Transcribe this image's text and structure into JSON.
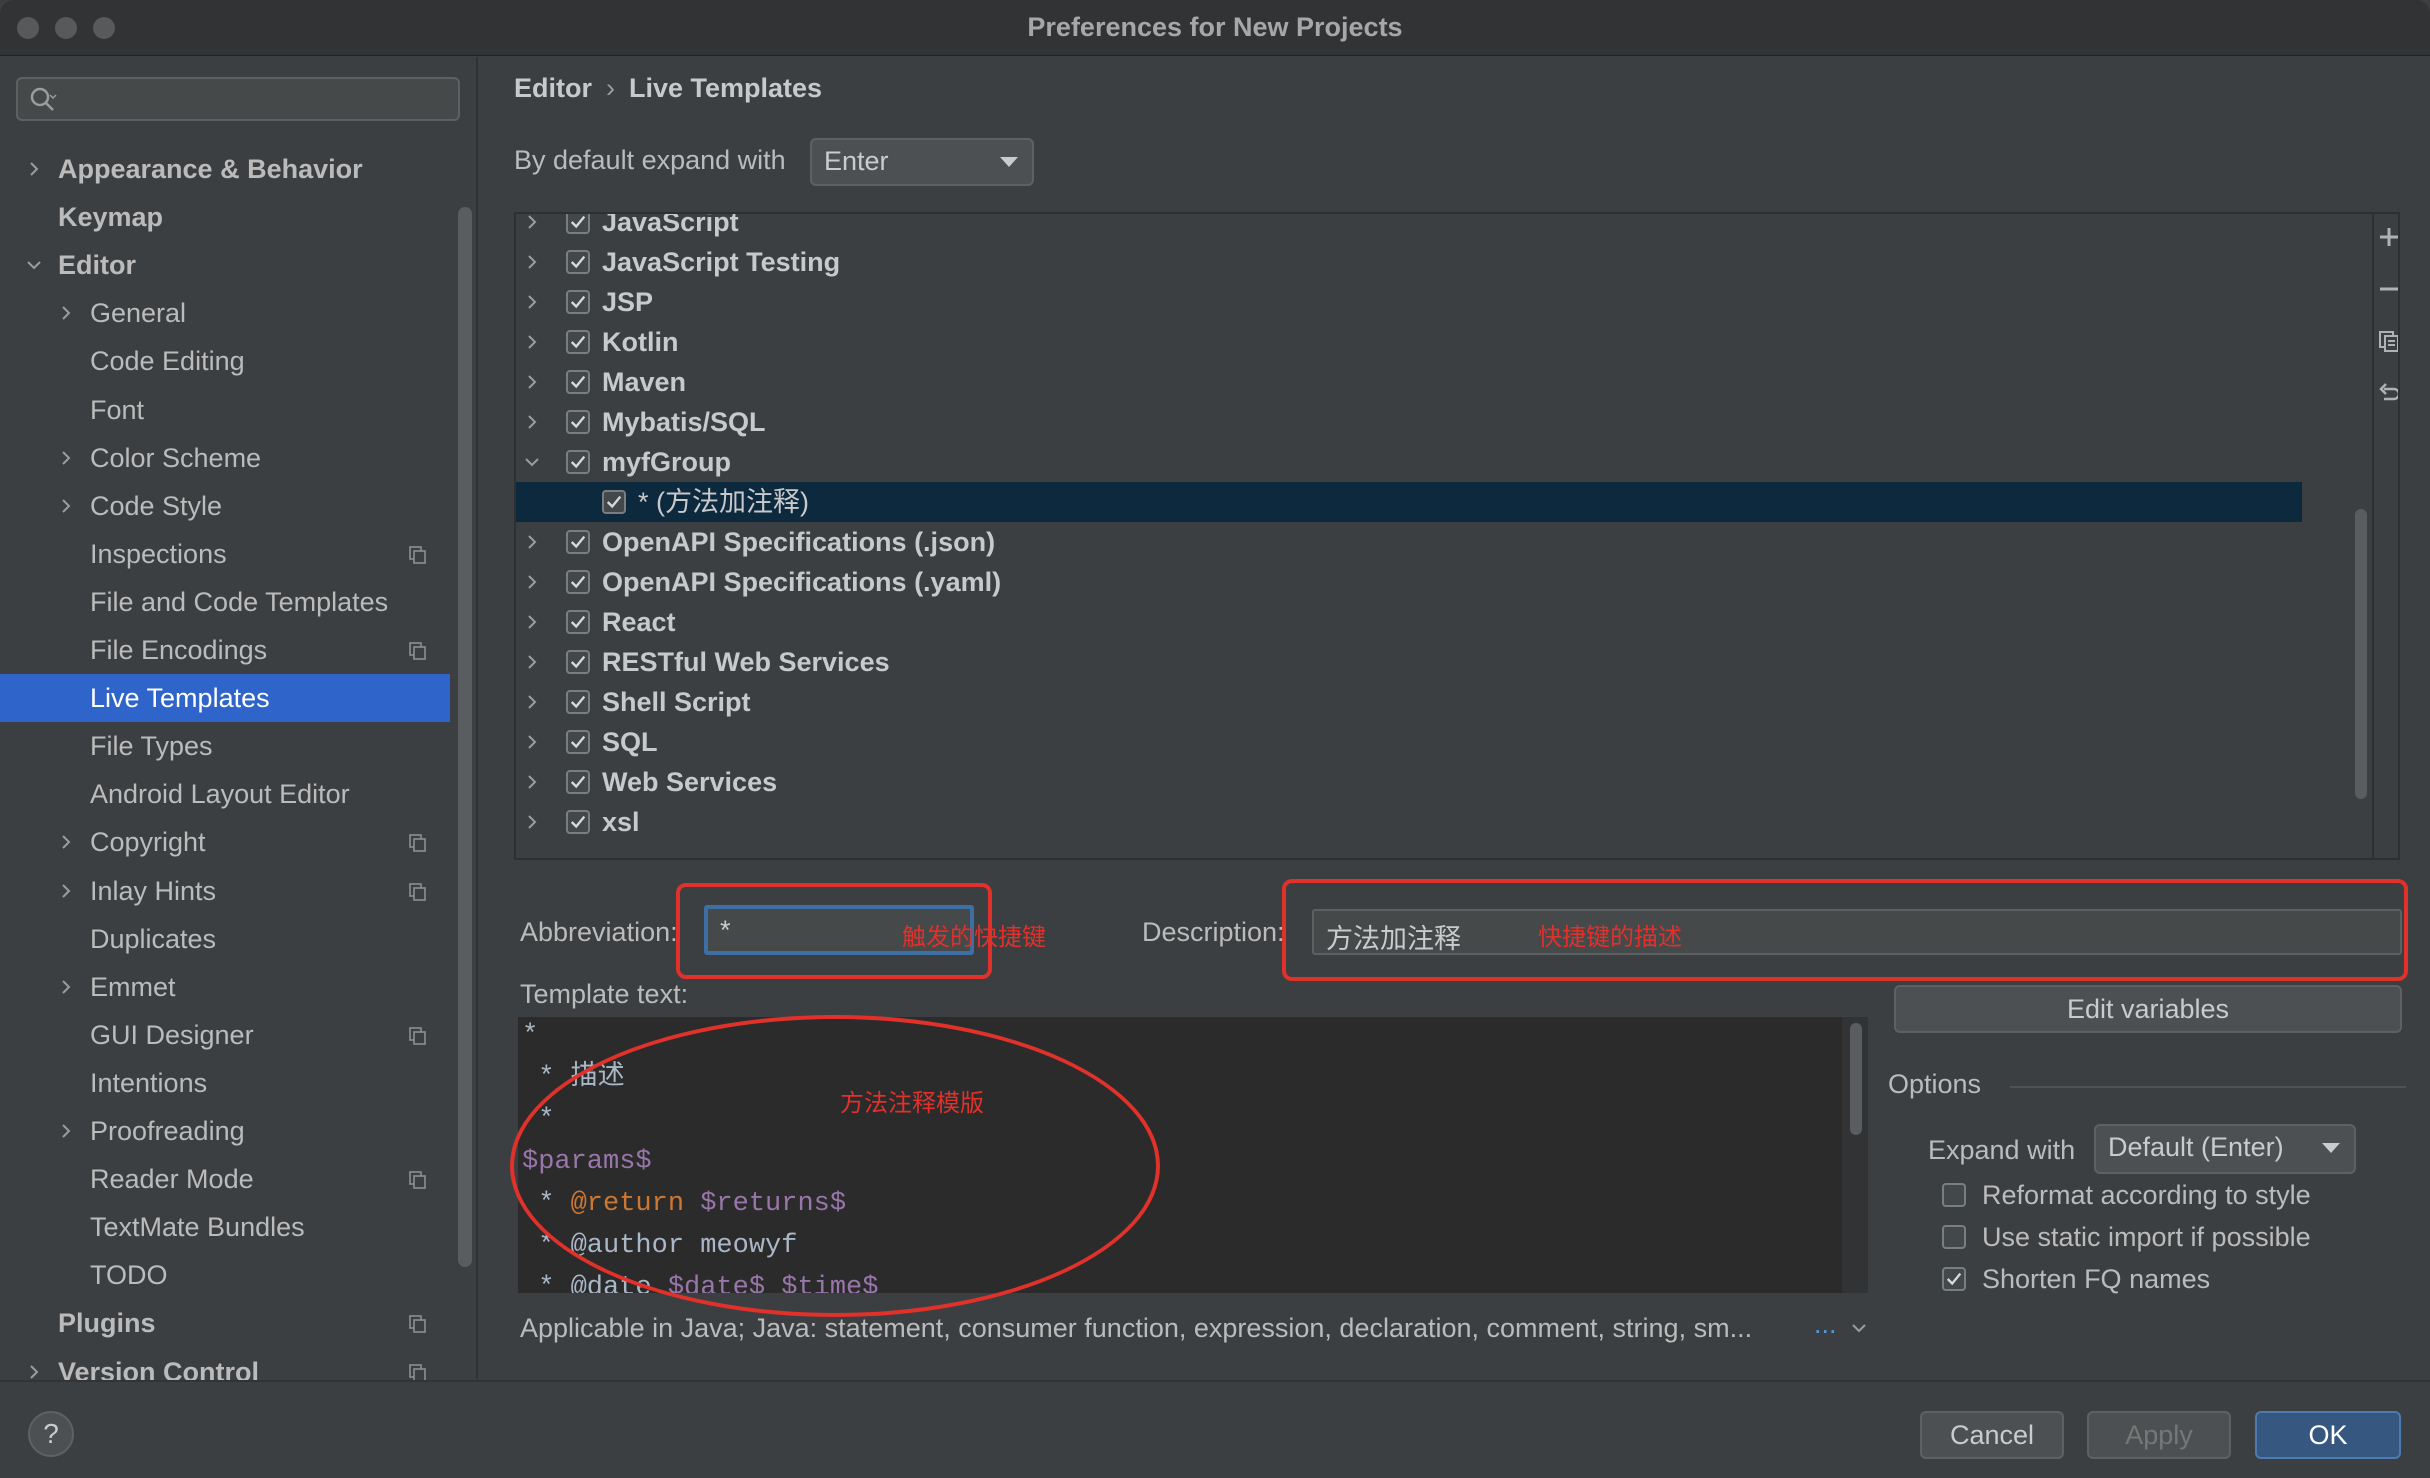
{
  "window": {
    "title": "Preferences for New Projects"
  },
  "search": {
    "placeholder": ""
  },
  "sidebar": {
    "items": [
      {
        "label": "Appearance & Behavior",
        "bold": true,
        "chevron": "right",
        "project": false
      },
      {
        "label": "Keymap",
        "bold": true,
        "chevron": "",
        "project": false
      },
      {
        "label": "Editor",
        "bold": true,
        "chevron": "down",
        "project": false
      },
      {
        "label": "General",
        "bold": false,
        "chevron": "right",
        "project": false
      },
      {
        "label": "Code Editing",
        "bold": false,
        "chevron": "",
        "project": false
      },
      {
        "label": "Font",
        "bold": false,
        "chevron": "",
        "project": false
      },
      {
        "label": "Color Scheme",
        "bold": false,
        "chevron": "right",
        "project": false
      },
      {
        "label": "Code Style",
        "bold": false,
        "chevron": "right",
        "project": false
      },
      {
        "label": "Inspections",
        "bold": false,
        "chevron": "",
        "project": true
      },
      {
        "label": "File and Code Templates",
        "bold": false,
        "chevron": "",
        "project": false
      },
      {
        "label": "File Encodings",
        "bold": false,
        "chevron": "",
        "project": true
      },
      {
        "label": "Live Templates",
        "bold": false,
        "chevron": "",
        "project": false,
        "selected": true
      },
      {
        "label": "File Types",
        "bold": false,
        "chevron": "",
        "project": false
      },
      {
        "label": "Android Layout Editor",
        "bold": false,
        "chevron": "",
        "project": false
      },
      {
        "label": "Copyright",
        "bold": false,
        "chevron": "right",
        "project": true
      },
      {
        "label": "Inlay Hints",
        "bold": false,
        "chevron": "right",
        "project": true
      },
      {
        "label": "Duplicates",
        "bold": false,
        "chevron": "",
        "project": false
      },
      {
        "label": "Emmet",
        "bold": false,
        "chevron": "right",
        "project": false
      },
      {
        "label": "GUI Designer",
        "bold": false,
        "chevron": "",
        "project": true
      },
      {
        "label": "Intentions",
        "bold": false,
        "chevron": "",
        "project": false
      },
      {
        "label": "Proofreading",
        "bold": false,
        "chevron": "right",
        "project": false
      },
      {
        "label": "Reader Mode",
        "bold": false,
        "chevron": "",
        "project": true
      },
      {
        "label": "TextMate Bundles",
        "bold": false,
        "chevron": "",
        "project": false
      },
      {
        "label": "TODO",
        "bold": false,
        "chevron": "",
        "project": false
      },
      {
        "label": "Plugins",
        "bold": true,
        "chevron": "",
        "project": true
      },
      {
        "label": "Version Control",
        "bold": true,
        "chevron": "right",
        "project": true
      }
    ]
  },
  "breadcrumb": {
    "parent": "Editor",
    "separator": "›",
    "current": "Live Templates"
  },
  "expand": {
    "label": "By default expand with",
    "value": "Enter"
  },
  "template_groups": [
    {
      "label": "JavaScript",
      "checked": true,
      "expanded": false
    },
    {
      "label": "JavaScript Testing",
      "checked": true,
      "expanded": false
    },
    {
      "label": "JSP",
      "checked": true,
      "expanded": false
    },
    {
      "label": "Kotlin",
      "checked": true,
      "expanded": false
    },
    {
      "label": "Maven",
      "checked": true,
      "expanded": false
    },
    {
      "label": "Mybatis/SQL",
      "checked": true,
      "expanded": false
    },
    {
      "label": "myfGroup",
      "checked": true,
      "expanded": true
    },
    {
      "label": "* (方法加注释)",
      "checked": true,
      "child": true,
      "selected": true
    },
    {
      "label": "OpenAPI Specifications (.json)",
      "checked": true,
      "expanded": false
    },
    {
      "label": "OpenAPI Specifications (.yaml)",
      "checked": true,
      "expanded": false
    },
    {
      "label": "React",
      "checked": true,
      "expanded": false
    },
    {
      "label": "RESTful Web Services",
      "checked": true,
      "expanded": false
    },
    {
      "label": "Shell Script",
      "checked": true,
      "expanded": false
    },
    {
      "label": "SQL",
      "checked": true,
      "expanded": false
    },
    {
      "label": "Web Services",
      "checked": true,
      "expanded": false
    },
    {
      "label": "xsl",
      "checked": true,
      "expanded": false
    }
  ],
  "toolbar": {
    "icons": [
      "add-icon",
      "remove-icon",
      "copy-icon",
      "restore-icon"
    ]
  },
  "abbreviation": {
    "label": "Abbreviation:",
    "value": "*",
    "annotation": "触发的快捷键"
  },
  "description": {
    "label": "Description:",
    "value": "方法加注释",
    "annotation": "快捷键的描述"
  },
  "template_text": {
    "label": "Template text:",
    "annotation": "方法注释模版",
    "lines": [
      [
        {
          "t": "*",
          "c": "plain"
        }
      ],
      [
        {
          "t": " * 描述",
          "c": "plain"
        }
      ],
      [
        {
          "t": " *",
          "c": "plain"
        }
      ],
      [
        {
          "t": "$params$",
          "c": "var"
        }
      ],
      [
        {
          "t": " * ",
          "c": "plain"
        },
        {
          "t": "@return",
          "c": "tag"
        },
        {
          "t": " ",
          "c": "plain"
        },
        {
          "t": "$returns$",
          "c": "var"
        }
      ],
      [
        {
          "t": " * ",
          "c": "plain"
        },
        {
          "t": "@author",
          "c": "plain"
        },
        {
          "t": " meowyf",
          "c": "plain"
        }
      ],
      [
        {
          "t": " * ",
          "c": "plain"
        },
        {
          "t": "@date",
          "c": "plain"
        },
        {
          "t": " ",
          "c": "plain"
        },
        {
          "t": "$date$",
          "c": "var"
        },
        {
          "t": " ",
          "c": "plain"
        },
        {
          "t": "$time$",
          "c": "var"
        }
      ]
    ]
  },
  "edit_variables": {
    "label": "Edit variables"
  },
  "options": {
    "title": "Options",
    "expand_label": "Expand with",
    "expand_value": "Default (Enter)",
    "checkboxes": [
      {
        "label": "Reformat according to style",
        "checked": false
      },
      {
        "label": "Use static import if possible",
        "checked": false
      },
      {
        "label": "Shorten FQ names",
        "checked": true
      }
    ]
  },
  "applicable": {
    "text": "Applicable in Java; Java: statement, consumer function, expression, declaration, comment, string, sm...",
    "more": "..."
  },
  "footer": {
    "help": "?",
    "cancel": "Cancel",
    "apply": "Apply",
    "ok": "OK"
  },
  "colors": {
    "accent": "#2f65ca",
    "selection": "#0d293e",
    "annotation": "#e0312b",
    "ok": "#365880"
  }
}
